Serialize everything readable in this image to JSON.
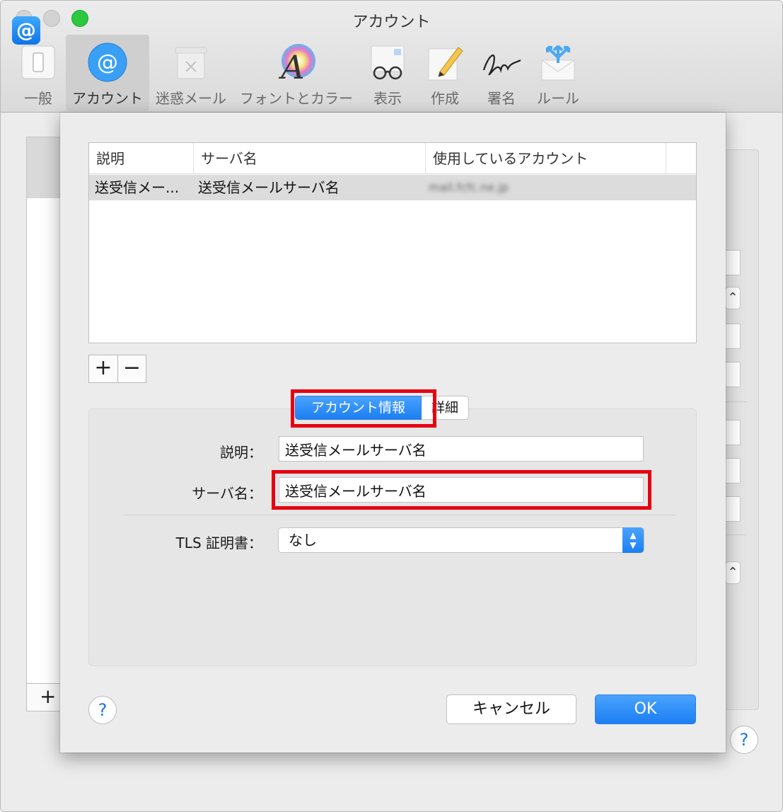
{
  "window": {
    "title": "アカウント"
  },
  "toolbar": {
    "items": [
      {
        "label": "一般",
        "icon": "switch-icon"
      },
      {
        "label": "アカウント",
        "icon": "at-icon"
      },
      {
        "label": "迷惑メール",
        "icon": "trash-bin-icon"
      },
      {
        "label": "フォントとカラー",
        "icon": "font-color-icon"
      },
      {
        "label": "表示",
        "icon": "glasses-icon"
      },
      {
        "label": "作成",
        "icon": "pencil-icon"
      },
      {
        "label": "署名",
        "icon": "signature-icon"
      },
      {
        "label": "ルール",
        "icon": "rules-icon"
      }
    ],
    "active_index": 1
  },
  "background": {
    "list_add": "+",
    "account_icon": "@",
    "help": "?"
  },
  "sheet": {
    "table": {
      "headers": [
        "説明",
        "サーバ名",
        "使用しているアカウント"
      ],
      "rows": [
        {
          "description": "送受信メー...",
          "server": "送受信メールサーバ名",
          "account": "mail.fcfc.ne.jp"
        }
      ]
    },
    "add_button": "+",
    "remove_button": "−",
    "tabs": {
      "account_info": "アカウント情報",
      "details": "詳細"
    },
    "form": {
      "description_label": "説明：",
      "description_value": "送受信メールサーバ名",
      "server_label": "サーバ名：",
      "server_value": "送受信メールサーバ名",
      "tls_label": "TLS 証明書：",
      "tls_value": "なし"
    },
    "help": "?",
    "cancel": "キャンセル",
    "ok": "OK"
  },
  "colors": {
    "accent": "#1c7ef2",
    "highlight": "#e60012"
  }
}
